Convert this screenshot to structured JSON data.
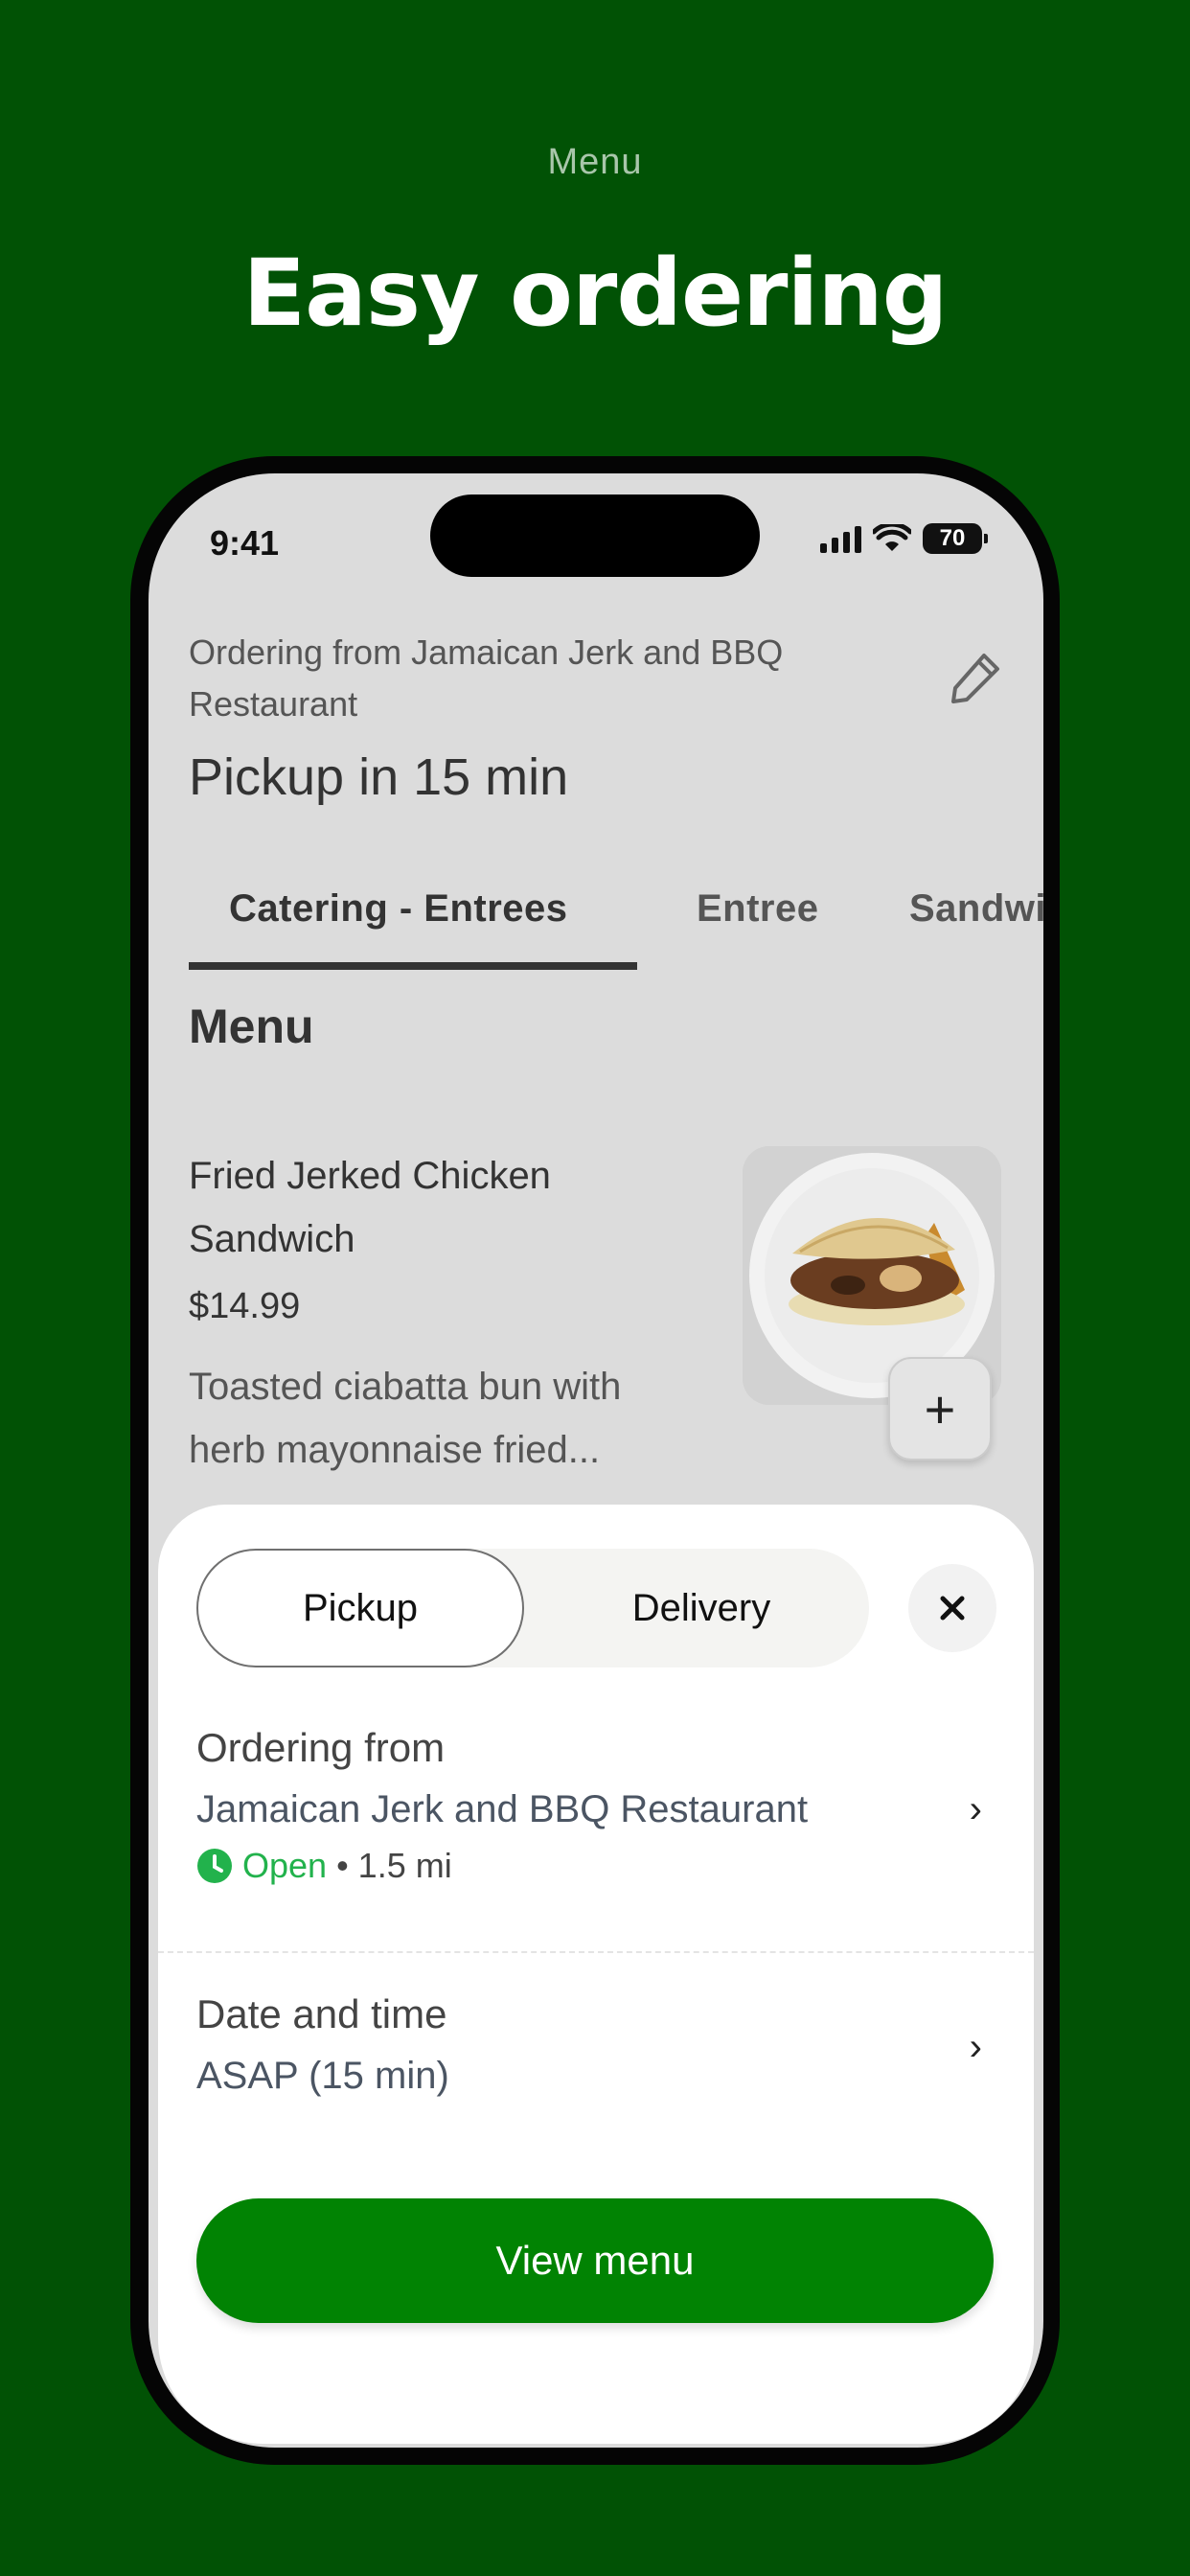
{
  "promo": {
    "subtitle": "Menu",
    "title": "Easy ordering"
  },
  "status_bar": {
    "time": "9:41",
    "battery": "70"
  },
  "header": {
    "ordering_from": "Ordering from Jamaican Jerk and BBQ Restaurant",
    "pickup_time": "Pickup in 15 min",
    "edit_icon": "pencil-icon"
  },
  "tabs": [
    {
      "label": "Catering - Entrees",
      "active": true
    },
    {
      "label": "Entree",
      "active": false
    },
    {
      "label": "Sandwic",
      "active": false
    }
  ],
  "menu": {
    "heading": "Menu",
    "item": {
      "name": "Fried Jerked Chicken Sandwich",
      "price": "$14.99",
      "description": "Toasted ciabatta bun with herb mayonnaise fried...",
      "add_icon": "plus-icon"
    }
  },
  "sheet": {
    "toggle": {
      "pickup": "Pickup",
      "delivery": "Delivery",
      "selected": "Pickup"
    },
    "close_icon": "close-icon",
    "ordering_from": {
      "title": "Ordering from",
      "restaurant": "Jamaican Jerk and BBQ Restaurant",
      "status": "Open",
      "distance": "• 1.5 mi"
    },
    "date_time": {
      "title": "Date and time",
      "value": "ASAP (15 min)"
    },
    "cta": "View menu"
  },
  "colors": {
    "background": "#015205",
    "accent": "#018303",
    "open_green": "#22b24c"
  }
}
